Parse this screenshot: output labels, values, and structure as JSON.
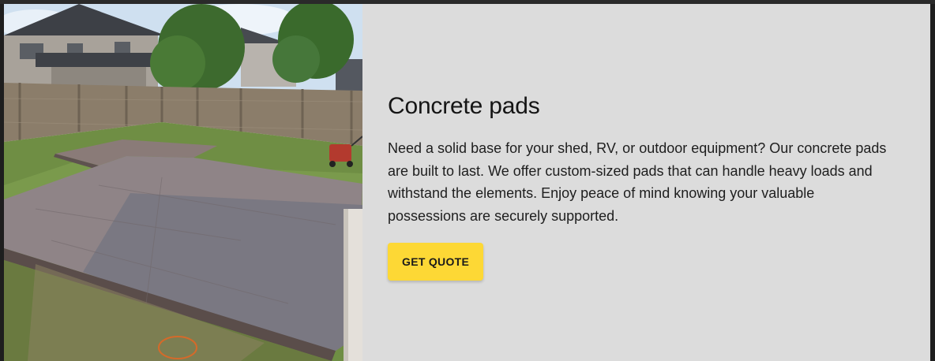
{
  "section": {
    "title": "Concrete pads",
    "description": "Need a solid base for your shed, RV, or outdoor equipment? Our concrete pads are built to last. We offer custom-sized pads that can handle heavy loads and withstand the elements. Enjoy peace of mind knowing your valuable possessions are securely supported.",
    "cta_label": "GET QUOTE"
  },
  "colors": {
    "panel_background": "#dcdcdc",
    "cta_background": "#fdd835",
    "title_text": "#151515"
  },
  "image": {
    "subject": "backyard-concrete-pad-photo"
  }
}
